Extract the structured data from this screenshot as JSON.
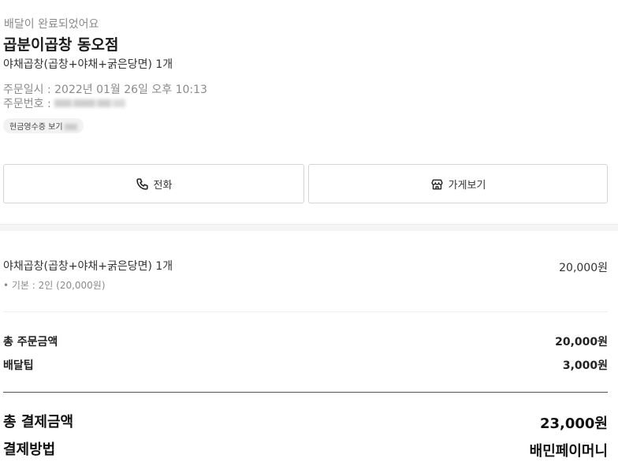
{
  "order": {
    "status": "배달이 완료되었어요",
    "store_name": "곱분이곱창 동오점",
    "menu_summary": "야채곱창(곱창+야채+굵은당면) 1개",
    "order_datetime": "주문일시 : 2022년 01월 26일 오후 10:13",
    "order_number_label": "주문번호 :",
    "receipt_chip": "현금영수증 보기"
  },
  "actions": {
    "call_label": "전화",
    "call_icon": "phone-icon",
    "store_label": "가게보기",
    "store_icon": "store-icon"
  },
  "items": [
    {
      "name": "야채곱창(곱창+야채+굵은당면) 1개",
      "price": "20,000원",
      "option": "• 기본 : 2인 (20,000원)"
    }
  ],
  "summary": {
    "order_total_label": "총 주문금액",
    "order_total_value": "20,000원",
    "delivery_tip_label": "배달팁",
    "delivery_tip_value": "3,000원",
    "payment_total_label": "총 결제금액",
    "payment_total_value": "23,000원",
    "payment_method_label": "결제방법",
    "payment_method_value": "배민페이머니"
  }
}
